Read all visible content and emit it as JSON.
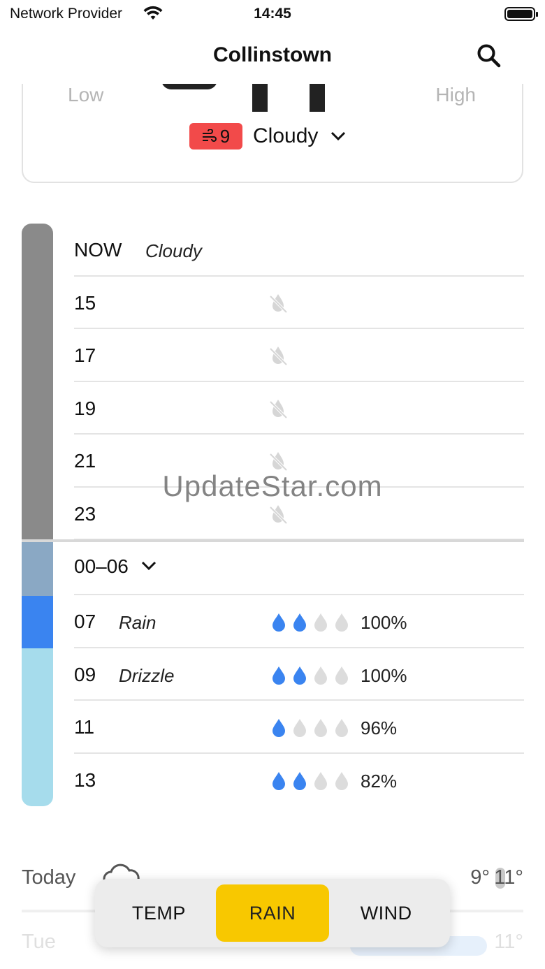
{
  "status_bar": {
    "carrier": "Network Provider",
    "time": "14:45"
  },
  "header": {
    "title": "Collinstown"
  },
  "summary": {
    "low_label": "Low",
    "high_label": "High",
    "wind_speed": "9",
    "condition": "Cloudy"
  },
  "hourly": [
    {
      "hour": "NOW",
      "desc": "Cloudy"
    },
    {
      "hour": "15"
    },
    {
      "hour": "17"
    },
    {
      "hour": "19"
    },
    {
      "hour": "21"
    },
    {
      "hour": "23"
    },
    {
      "hour": "00–06"
    },
    {
      "hour": "07",
      "desc": "Rain",
      "drops_filled": 2,
      "chance": "100%"
    },
    {
      "hour": "09",
      "desc": "Drizzle",
      "drops_filled": 2,
      "chance": "100%"
    },
    {
      "hour": "11",
      "drops_filled": 1,
      "chance": "96%"
    },
    {
      "hour": "13",
      "drops_filled": 2,
      "chance": "82%"
    }
  ],
  "timeline_colors": {
    "cloudy": "#8a8a8a",
    "night": "#8aa8c4",
    "rain": "#3a84f0",
    "drizzle": "#a6dcec"
  },
  "watermark": "UpdateStar.com",
  "daily": [
    {
      "day": "Today",
      "low": "9°",
      "high": "11°"
    },
    {
      "day": "Tue",
      "high": "11°"
    }
  ],
  "tabs": {
    "temp": "TEMP",
    "rain": "RAIN",
    "wind": "WIND",
    "selected": "RAIN"
  },
  "colors": {
    "accent": "#f8c800",
    "wind_badge": "#f24a4a",
    "drop_blue": "#3a84f0",
    "drop_grey": "#dcdcdc"
  }
}
